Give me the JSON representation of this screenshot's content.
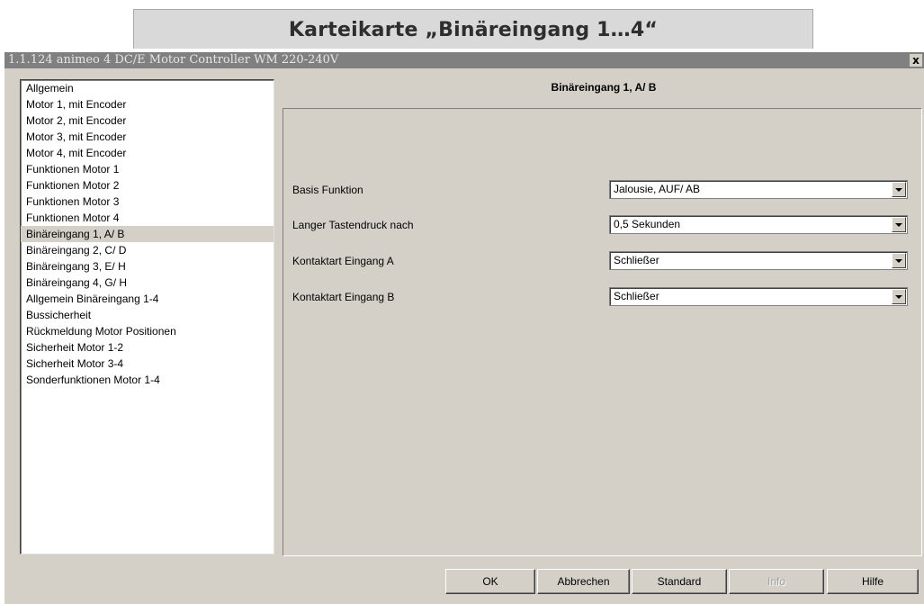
{
  "caption": "Karteikarte „Binäreingang 1…4“",
  "window": {
    "title": "1.1.124 animeo 4 DC/E Motor Controller WM 220-240V",
    "close_label": "x"
  },
  "nav": {
    "items": [
      {
        "label": "Allgemein",
        "selected": false
      },
      {
        "label": "Motor 1, mit Encoder",
        "selected": false
      },
      {
        "label": "Motor 2, mit Encoder",
        "selected": false
      },
      {
        "label": "Motor 3, mit Encoder",
        "selected": false
      },
      {
        "label": "Motor 4, mit Encoder",
        "selected": false
      },
      {
        "label": "Funktionen Motor 1",
        "selected": false
      },
      {
        "label": "Funktionen Motor 2",
        "selected": false
      },
      {
        "label": "Funktionen Motor 3",
        "selected": false
      },
      {
        "label": "Funktionen Motor 4",
        "selected": false
      },
      {
        "label": "Binäreingang 1, A/ B",
        "selected": true
      },
      {
        "label": "Binäreingang 2, C/ D",
        "selected": false
      },
      {
        "label": "Binäreingang 3, E/ H",
        "selected": false
      },
      {
        "label": "Binäreingang 4, G/ H",
        "selected": false
      },
      {
        "label": "Allgemein Binäreingang 1-4",
        "selected": false
      },
      {
        "label": "Bussicherheit",
        "selected": false
      },
      {
        "label": "Rückmeldung Motor Positionen",
        "selected": false
      },
      {
        "label": "Sicherheit Motor 1-2",
        "selected": false
      },
      {
        "label": "Sicherheit Motor 3-4",
        "selected": false
      },
      {
        "label": "Sonderfunktionen Motor 1-4",
        "selected": false
      }
    ]
  },
  "section": {
    "title": "Binäreingang 1, A/ B",
    "params": [
      {
        "label": "Basis Funktion",
        "value": "Jalousie, AUF/ AB"
      },
      {
        "label": "Langer Tastendruck nach",
        "value": "0,5 Sekunden"
      },
      {
        "label": "Kontaktart Eingang A",
        "value": "Schließer"
      },
      {
        "label": "Kontaktart Eingang B",
        "value": "Schließer"
      }
    ]
  },
  "buttons": {
    "ok": "OK",
    "cancel": "Abbrechen",
    "standard": "Standard",
    "info": "Info",
    "help": "Hilfe"
  }
}
